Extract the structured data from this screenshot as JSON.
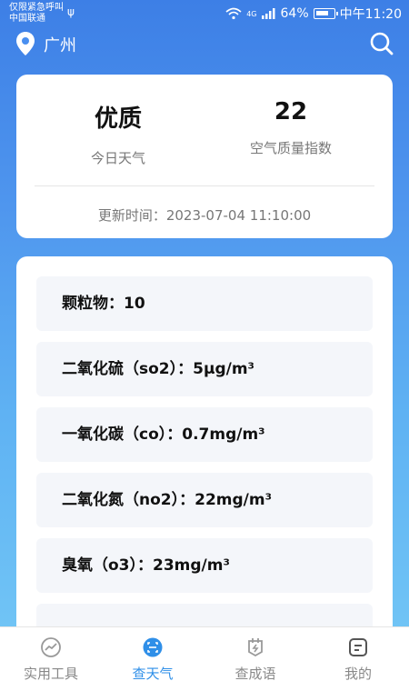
{
  "status_bar": {
    "line1": "仅限紧急呼叫",
    "line2": "中国联通",
    "network": "4G",
    "battery": "64%",
    "time": "中午11:20"
  },
  "header": {
    "city": "广州"
  },
  "summary": {
    "quality_value": "优质",
    "quality_label": "今日天气",
    "aqi_value": "22",
    "aqi_label": "空气质量指数",
    "update_text": "更新时间：2023-07-04 11:10:00"
  },
  "pollutants": [
    "颗粒物：10",
    "二氧化硫（so2）：5μg/m³",
    "一氧化碳（co）：0.7mg/m³",
    "二氧化氮（no2）：22mg/m³",
    "臭氧（o3）：23mg/m³"
  ],
  "tabs": [
    {
      "label": "实用工具",
      "icon": "chart-icon"
    },
    {
      "label": "查天气",
      "icon": "weather-scan-icon"
    },
    {
      "label": "查成语",
      "icon": "idiom-icon"
    },
    {
      "label": "我的",
      "icon": "profile-icon"
    }
  ],
  "colors": {
    "accent": "#2f8fe8",
    "background_top": "#3d7fe6",
    "background_bottom": "#75c9f6"
  }
}
